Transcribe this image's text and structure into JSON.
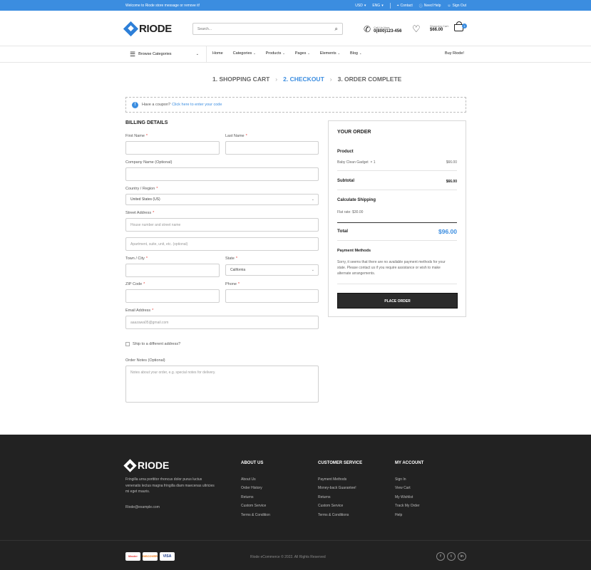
{
  "topbar": {
    "message": "Welcome to Riode store message or remove it!",
    "currency": "USD",
    "language": "ENG",
    "contact": "Contact",
    "need_help": "Need Help",
    "sign_out": "Sign Out"
  },
  "header": {
    "logo": "RIODE",
    "search_placeholder": "Search...",
    "call_label": "Call Us Now:",
    "call_number": "0(800)123-456",
    "cart_label": "Shopping Cart:",
    "cart_total": "$66.00",
    "cart_count": "1"
  },
  "nav": {
    "browse": "Browse Categories",
    "items": [
      "Home",
      "Categories",
      "Products",
      "Pages",
      "Elements",
      "Blog"
    ],
    "buy": "Buy Riode!"
  },
  "steps": {
    "s1": "1. SHOPPING CART",
    "s2": "2. CHECKOUT",
    "s3": "3. ORDER COMPLETE"
  },
  "coupon": {
    "text": "Have a coupon?",
    "link": "Click here to enter your code"
  },
  "billing": {
    "title": "BILLING DETAILS",
    "first_name": "First Name",
    "last_name": "Last Name",
    "company": "Company Name (Optional)",
    "country": "Country / Region",
    "country_value": "United States (US)",
    "street": "Street Address",
    "street_ph1": "House number and street name",
    "street_ph2": "Apartment, suite, unit, etc. (optional)",
    "town": "Town / City",
    "state": "State",
    "state_value": "California",
    "zip": "ZIP Code",
    "phone": "Phone",
    "email": "Email Address",
    "email_value": "aaazawa05@gmail.com",
    "ship_diff": "Ship to a different address?",
    "notes": "Order Notes (Optional)",
    "notes_ph": "Notes about your order, e.g. special notes for delivery.",
    "req": "*"
  },
  "order": {
    "title": "YOUR ORDER",
    "product_h": "Product",
    "product_name": "Baby Clean Gadget",
    "product_qty": "× 1",
    "product_price": "$66.00",
    "subtotal_h": "Subtotal",
    "subtotal": "$66.00",
    "shipping_h": "Calculate Shipping",
    "flat_rate": "Flat rate: $30.00",
    "total_h": "Total",
    "total": "$96.00",
    "pm_h": "Payment Methods",
    "pm_text": "Sorry, it seems that there are no available payment methods for your state. Please contact us if you require assistance or wish to make alternate arrangements.",
    "place": "PLACE ORDER"
  },
  "footer": {
    "logo": "RIODE",
    "desc": "Fringilla urna porttitor rhoncus dolor purus luctus venenatis lectus magna fringilla diam maecenas ultricies mi eget mauris.",
    "email": "Riode@example.com",
    "about": {
      "title": "ABOUT US",
      "items": [
        "About Us",
        "Order History",
        "Returns",
        "Custom Service",
        "Terms & Condition"
      ]
    },
    "service": {
      "title": "CUSTOMER SERVICE",
      "items": [
        "Payment Methods",
        "Money-back Guarantee!",
        "Returns",
        "Custom Service",
        "Terms & Conditions"
      ]
    },
    "account": {
      "title": "MY ACCOUNT",
      "items": [
        "Sign In",
        "View Cart",
        "My Wishlist",
        "Track My Order",
        "Help"
      ]
    },
    "pay": {
      "mc": "Master",
      "dc": "DISCOVER",
      "vi": "VISA"
    },
    "copyright": "Riode eCommerce © 2022. All Rights Reserved",
    "social": {
      "fb": "f",
      "tw": "t",
      "in": "in"
    }
  },
  "colors": {
    "accent": "#3b8de0",
    "dark": "#222222"
  }
}
